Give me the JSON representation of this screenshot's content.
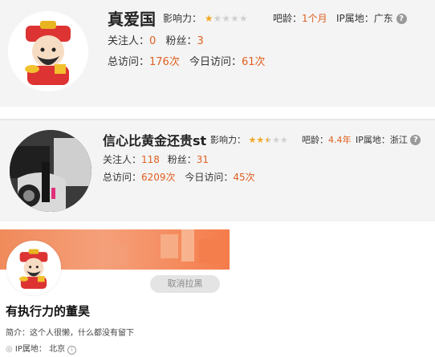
{
  "card1": {
    "name": "真爱国",
    "influence_label": "影响力：",
    "influence_stars": 1,
    "age_label": "吧龄：",
    "age_value": "1个月",
    "ip_label": "IP属地：",
    "ip_value": "广东",
    "follow_label": "关注人：",
    "follow_value": "0",
    "fans_label": "粉丝：",
    "fans_value": "3",
    "total_label": "总访问：",
    "total_value": "176次",
    "today_label": "今日访问：",
    "today_value": "61次"
  },
  "card2": {
    "name": "信心比黄金还贵st",
    "influence_label": "影响力：",
    "influence_stars": 2.5,
    "age_label": "吧龄：",
    "age_value": "4.4年",
    "ip_label": "IP属地：",
    "ip_value": "浙江",
    "follow_label": "关注人：",
    "follow_value": "118",
    "fans_label": "粉丝：",
    "fans_value": "31",
    "total_label": "总访问：",
    "total_value": "6209次",
    "today_label": "今日访问：",
    "today_value": "45次"
  },
  "card3": {
    "unblock_label": "取消拉黑",
    "name": "有执行力的董昊",
    "bio_label": "简介：",
    "bio_text": "这个人很懒，什么都没有留下",
    "ip_label": "IP属地：",
    "ip_value": "北京"
  },
  "colors": {
    "accent": "#e06020",
    "star": "#f5a623"
  }
}
